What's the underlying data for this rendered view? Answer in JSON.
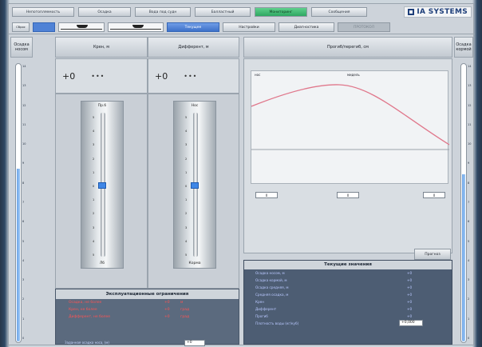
{
  "top_nav": [
    {
      "label": "Непотопляемость",
      "active": false
    },
    {
      "label": "Осадка",
      "active": false
    },
    {
      "label": "Вода под судн",
      "active": false
    },
    {
      "label": "Балластный",
      "active": false
    },
    {
      "label": "Мониторинг",
      "active": true
    },
    {
      "label": "Сообщения",
      "active": false
    }
  ],
  "brand": {
    "name": "IA SYSTEMS",
    "color": "#1e3f7a"
  },
  "sub_toolbar": {
    "mini_buttons": [
      "Сброс",
      ""
    ],
    "tabs": [
      {
        "label": "Текущее",
        "state": "on"
      },
      {
        "label": "Настройки",
        "state": "normal"
      },
      {
        "label": "Диагностика",
        "state": "normal"
      },
      {
        "label": "ПРОТОКОЛ",
        "state": "dim"
      }
    ]
  },
  "columns": {
    "left_draft": "Осадка носом",
    "heel": "Крен, м",
    "trim": "Дифферент, м",
    "deflection": "Прогиб/перегиб, см",
    "right_draft": "Осадка кормой"
  },
  "draft_left": {
    "fill_fraction": 0.62,
    "ticks": [
      "14",
      "13",
      "12",
      "11",
      "10",
      "9",
      "8",
      "7",
      "6",
      "5",
      "4",
      "3",
      "2",
      "1",
      "0"
    ]
  },
  "draft_right": {
    "fill_fraction": 0.6,
    "ticks": [
      "14",
      "13",
      "12",
      "11",
      "10",
      "9",
      "8",
      "7",
      "6",
      "5",
      "4",
      "3",
      "2",
      "1",
      "0"
    ]
  },
  "heel": {
    "value": "+0",
    "dots": "•••",
    "top_label": "Пр.б",
    "bottom_label": "Лб",
    "marker_fraction": 0.5,
    "ticks": [
      "5",
      "4",
      "3",
      "2",
      "1",
      "0",
      "1",
      "2",
      "3",
      "4",
      "5"
    ]
  },
  "trim": {
    "value": "+0",
    "dots": "•••",
    "top_label": "Нос",
    "bottom_label": "Корма",
    "marker_fraction": 0.5,
    "ticks": [
      "5",
      "4",
      "3",
      "2",
      "1",
      "0",
      "1",
      "2",
      "3",
      "4",
      "5"
    ]
  },
  "deflection_chart": {
    "corner_label": "нос",
    "mid_label": "мидель",
    "pins": [
      "0",
      "0",
      "0"
    ]
  },
  "limits": {
    "title": "Эксплуатационные ограничения",
    "rows": [
      {
        "name": "Осадка, не более",
        "val": "+0",
        "unit": "м"
      },
      {
        "name": "Крен, не более",
        "val": "+0",
        "unit": "град"
      },
      {
        "name": "Дифферент, не более",
        "val": "+0",
        "unit": "град"
      }
    ],
    "set_label": "Заданная осадка носа, (м)",
    "set_value": "+0"
  },
  "current": {
    "title": "Текущие значения",
    "rows": [
      {
        "name": "Осадка носом, м",
        "val": "+0"
      },
      {
        "name": "Осадка кормой, м",
        "val": "+0"
      },
      {
        "name": "Осадка средняя, м",
        "val": "+0"
      },
      {
        "name": "Средняя осадка, м",
        "val": "+0"
      },
      {
        "name": "Крен",
        "val": "+0"
      },
      {
        "name": "Дифферент",
        "val": "+0"
      },
      {
        "name": "Прогиб",
        "val": "+0"
      }
    ],
    "input_label": "Плотность воды (кг/куб)",
    "input_value": "+0,000"
  },
  "previous_button": "Прогноз"
}
